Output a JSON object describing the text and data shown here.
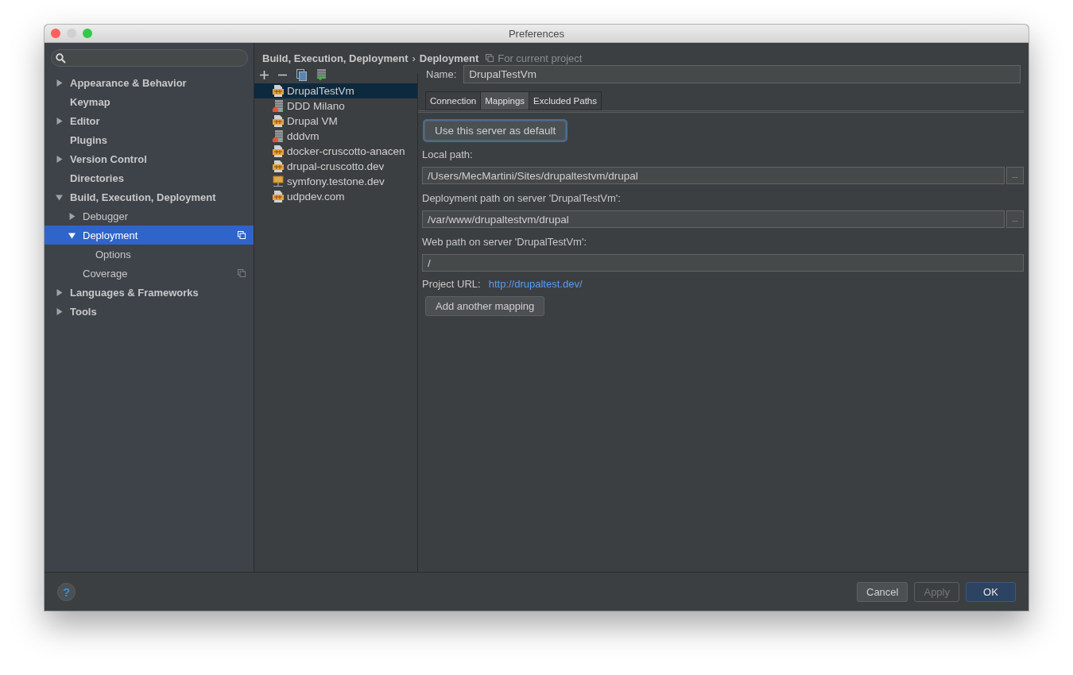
{
  "window": {
    "title": "Preferences"
  },
  "sidebar": {
    "items": [
      {
        "label": "Appearance & Behavior",
        "expanded": false,
        "selected": false
      },
      {
        "label": "Keymap",
        "selected": false
      },
      {
        "label": "Editor",
        "expanded": false,
        "selected": false
      },
      {
        "label": "Plugins",
        "selected": false
      },
      {
        "label": "Version Control",
        "expanded": false,
        "selected": false
      },
      {
        "label": "Directories",
        "selected": false
      },
      {
        "label": "Build, Execution, Deployment",
        "expanded": true,
        "selected": false,
        "children": [
          {
            "label": "Debugger",
            "expanded": false,
            "selected": false
          },
          {
            "label": "Deployment",
            "expanded": true,
            "selected": true,
            "project_scoped": true,
            "children": [
              {
                "label": "Options",
                "selected": false
              }
            ]
          },
          {
            "label": "Coverage",
            "selected": false,
            "project_scoped": true
          }
        ]
      },
      {
        "label": "Languages & Frameworks",
        "expanded": false,
        "selected": false
      },
      {
        "label": "Tools",
        "expanded": false,
        "selected": false
      }
    ]
  },
  "breadcrumb": {
    "parent": "Build, Execution, Deployment",
    "separator": "›",
    "current": "Deployment",
    "scope": "For current project"
  },
  "servers": [
    {
      "name": "DrupalTestVm",
      "kind": "sftp",
      "selected": true
    },
    {
      "name": "DDD Milano",
      "kind": "local",
      "selected": false
    },
    {
      "name": "Drupal VM",
      "kind": "sftp",
      "selected": false
    },
    {
      "name": "dddvm",
      "kind": "local",
      "selected": false
    },
    {
      "name": "docker-cruscotto-anacen",
      "kind": "sftp",
      "selected": false
    },
    {
      "name": "drupal-cruscotto.dev",
      "kind": "sftp",
      "selected": false
    },
    {
      "name": "symfony.testone.dev",
      "kind": "mount",
      "selected": false
    },
    {
      "name": "udpdev.com",
      "kind": "sftp",
      "selected": false
    }
  ],
  "details": {
    "name_label": "Name:",
    "name_value": "DrupalTestVm",
    "tabs": [
      {
        "label": "Connection",
        "selected": false
      },
      {
        "label": "Mappings",
        "selected": true
      },
      {
        "label": "Excluded Paths",
        "selected": false
      }
    ],
    "default_button": "Use this server as default",
    "fields": [
      {
        "label": "Local path:",
        "value": "/Users/MecMartini/Sites/drupaltestvm/drupal",
        "browse": "..."
      },
      {
        "label": "Deployment path on server 'DrupalTestVm':",
        "value": "/var/www/drupaltestvm/drupal",
        "browse": "..."
      },
      {
        "label": "Web path on server 'DrupalTestVm':",
        "value": "/"
      }
    ],
    "project_url_label": "Project URL:",
    "project_url": "http://drupaltest.dev/",
    "add_button": "Add another mapping"
  },
  "footer": {
    "help": "?",
    "buttons": [
      {
        "label": "Cancel",
        "kind": "normal",
        "disabled": false
      },
      {
        "label": "Apply",
        "kind": "normal",
        "disabled": true
      },
      {
        "label": "OK",
        "kind": "default",
        "disabled": false
      }
    ]
  }
}
